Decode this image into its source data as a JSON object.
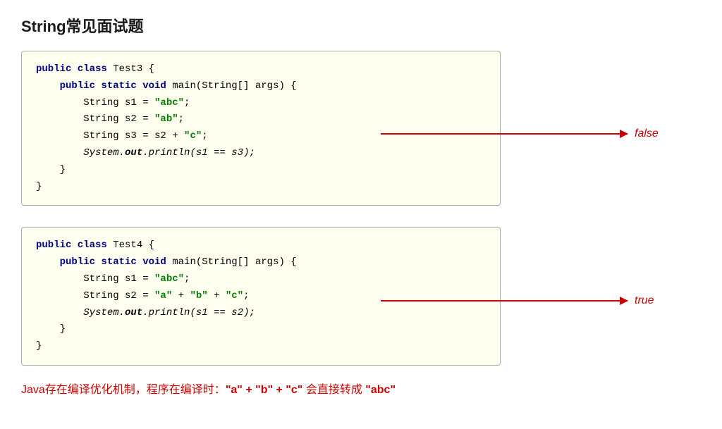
{
  "page": {
    "title": "String常见面试题"
  },
  "code_block_1": {
    "lines": [
      {
        "type": "code",
        "indent": 0,
        "parts": [
          {
            "t": "kw",
            "v": "public class"
          },
          {
            "t": "normal",
            "v": " Test3 {"
          }
        ]
      },
      {
        "type": "code",
        "indent": 1,
        "parts": [
          {
            "t": "kw",
            "v": "public static void"
          },
          {
            "t": "normal",
            "v": " main(String[] args) {"
          }
        ]
      },
      {
        "type": "code",
        "indent": 2,
        "parts": [
          {
            "t": "normal",
            "v": "String s1 = "
          },
          {
            "t": "str",
            "v": "\"abc\""
          },
          {
            "t": "normal",
            "v": ";"
          }
        ]
      },
      {
        "type": "code",
        "indent": 2,
        "parts": [
          {
            "t": "normal",
            "v": "String s2 = "
          },
          {
            "t": "str",
            "v": "\"ab\""
          },
          {
            "t": "normal",
            "v": ";"
          }
        ]
      },
      {
        "type": "code",
        "indent": 2,
        "parts": [
          {
            "t": "normal",
            "v": "String s3 = s2 + "
          },
          {
            "t": "str",
            "v": "\"c\""
          },
          {
            "t": "normal",
            "v": ";"
          }
        ]
      },
      {
        "type": "arrow",
        "indent": 2,
        "parts": [
          {
            "t": "italic",
            "v": "System."
          },
          {
            "t": "italic-bold",
            "v": "out"
          },
          {
            "t": "italic",
            "v": ".println(s1 == s3);"
          }
        ]
      },
      {
        "type": "code",
        "indent": 1,
        "parts": [
          {
            "t": "normal",
            "v": "}"
          }
        ]
      },
      {
        "type": "code",
        "indent": 0,
        "parts": [
          {
            "t": "normal",
            "v": "}"
          }
        ]
      }
    ],
    "arrow": {
      "label": "false",
      "row_index": 5
    }
  },
  "code_block_2": {
    "lines": [
      {
        "type": "code",
        "indent": 0,
        "parts": [
          {
            "t": "kw",
            "v": "public class"
          },
          {
            "t": "normal",
            "v": " Test4 {"
          }
        ]
      },
      {
        "type": "code",
        "indent": 1,
        "parts": [
          {
            "t": "kw",
            "v": "public static void"
          },
          {
            "t": "normal",
            "v": " main(String[] args) {"
          }
        ]
      },
      {
        "type": "code",
        "indent": 2,
        "parts": [
          {
            "t": "normal",
            "v": "String s1 = "
          },
          {
            "t": "str",
            "v": "\"abc\""
          },
          {
            "t": "normal",
            "v": ";"
          }
        ]
      },
      {
        "type": "code",
        "indent": 2,
        "parts": [
          {
            "t": "normal",
            "v": "String s2 = "
          },
          {
            "t": "str",
            "v": "\"a\""
          },
          {
            "t": "normal",
            "v": " + "
          },
          {
            "t": "str",
            "v": "\"b\""
          },
          {
            "t": "normal",
            "v": " + "
          },
          {
            "t": "str",
            "v": "\"c\""
          },
          {
            "t": "normal",
            "v": ";"
          }
        ]
      },
      {
        "type": "arrow",
        "indent": 2,
        "parts": [
          {
            "t": "italic",
            "v": "System."
          },
          {
            "t": "italic-bold",
            "v": "out"
          },
          {
            "t": "italic",
            "v": ".println(s1 == s2);"
          }
        ]
      },
      {
        "type": "code",
        "indent": 1,
        "parts": [
          {
            "t": "normal",
            "v": "}"
          }
        ]
      },
      {
        "type": "code",
        "indent": 0,
        "parts": [
          {
            "t": "normal",
            "v": "}"
          }
        ]
      }
    ],
    "arrow": {
      "label": "true",
      "row_index": 4
    }
  },
  "footer": {
    "text_normal": "Java存在编译优化机制，程序在编译时：",
    "text_code": "\"a\" + \"b\" + \"c\"",
    "text_result": " 会直接转成 ",
    "text_result2": "\"abc\""
  }
}
